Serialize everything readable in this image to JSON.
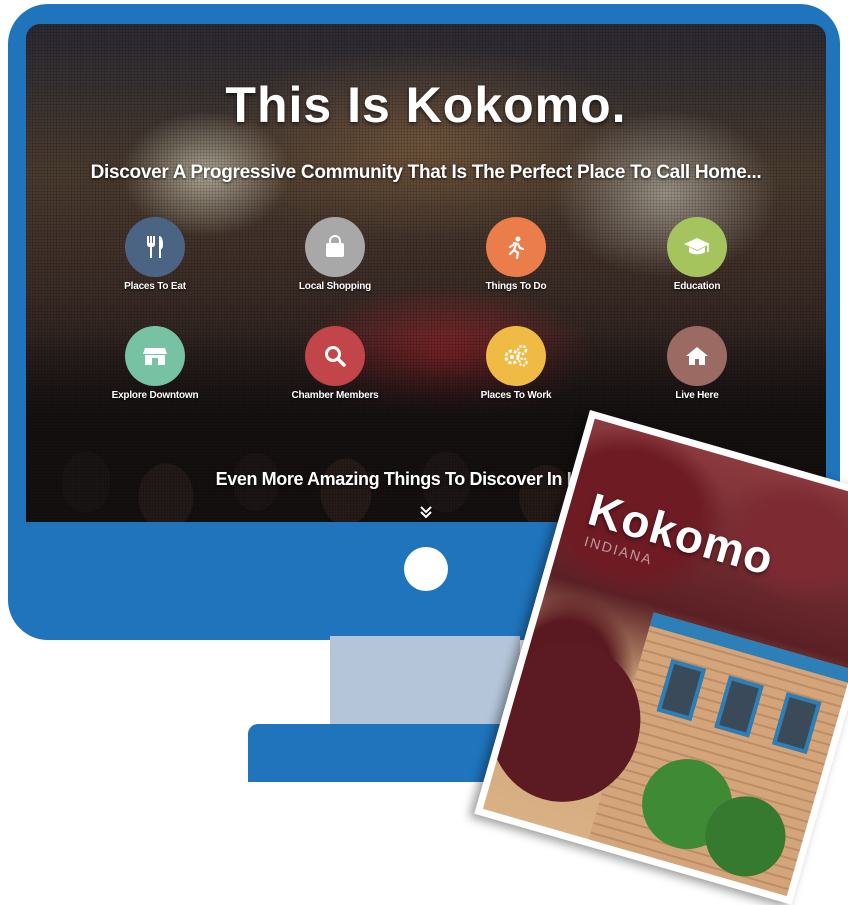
{
  "hero": {
    "title": "This Is Kokomo.",
    "subtitle": "Discover A Progressive Community That Is The Perfect Place To Call Home..."
  },
  "categories": [
    {
      "label": "Places To Eat",
      "icon": "fork-knife-icon",
      "color": "#4c6484"
    },
    {
      "label": "Local Shopping",
      "icon": "shopping-bag-icon",
      "color": "#a8a8a8"
    },
    {
      "label": "Things To Do",
      "icon": "running-person-icon",
      "color": "#ea7d4a"
    },
    {
      "label": "Education",
      "icon": "graduation-cap-icon",
      "color": "#a6c45d"
    },
    {
      "label": "Explore Downtown",
      "icon": "storefront-icon",
      "color": "#77c2a3"
    },
    {
      "label": "Chamber Members",
      "icon": "search-icon",
      "color": "#c2454a"
    },
    {
      "label": "Places To Work",
      "icon": "gears-icon",
      "color": "#f0bb45"
    },
    {
      "label": "Live Here",
      "icon": "house-icon",
      "color": "#9a6a63"
    }
  ],
  "discover_more": "Even More Amazing Things To Discover In Kokomo",
  "magazine": {
    "title": "Kokomo",
    "subtitle": "INDIANA"
  },
  "colors": {
    "monitor": "#1f74bc",
    "stand": "#b4c5d9"
  }
}
